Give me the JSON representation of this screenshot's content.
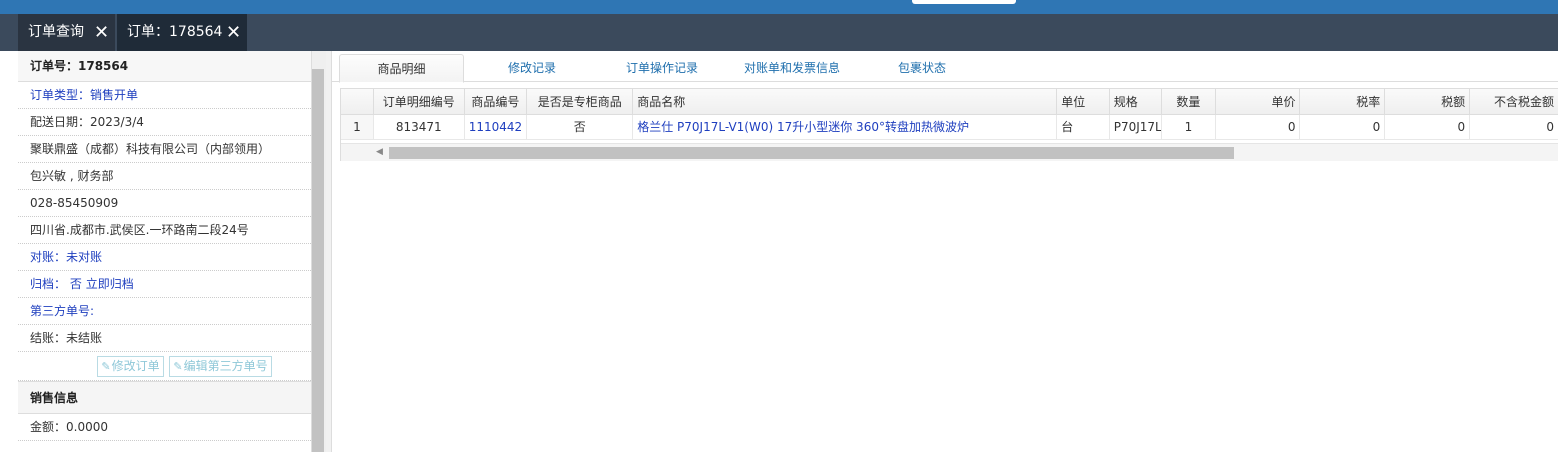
{
  "tabs": [
    {
      "label": "订单查询",
      "close": "✕"
    },
    {
      "label": "订单：178564",
      "close": "✕"
    }
  ],
  "left": {
    "order_no": "订单号：178564",
    "order_type": "订单类型：销售开单",
    "delivery_date": "配送日期：2023/3/4",
    "company": "聚联鼎盛（成都）科技有限公司（内部领用）",
    "contact": "包兴敏 , 财务部",
    "phone": "028-85450909",
    "address": "四川省.成都市.武侯区.一环路南二段24号",
    "reconcile": "对账：未对账",
    "archive_label": "归档：",
    "archive_value": "否",
    "archive_link": "立即归档",
    "third_party": "第三方单号:",
    "settlement": "结账：未结账",
    "btn_edit_order": "修改订单",
    "btn_edit_third": "编辑第三方单号",
    "sales_section": "销售信息",
    "amount": "金额：0.0000"
  },
  "right_tabs": [
    "商品明细",
    "修改记录",
    "订单操作记录",
    "对账单和发票信息",
    "包裹状态"
  ],
  "grid": {
    "headers": [
      "",
      "订单明细编号",
      "商品编号",
      "是否是专柜商品",
      "商品名称",
      "单位",
      "规格",
      "数量",
      "单价",
      "税率",
      "税额",
      "不含税金额"
    ],
    "rows": [
      [
        "1",
        "813471",
        "1110442",
        "否",
        "格兰仕 P70J17L-V1(W0) 17升小型迷你 360°转盘加热微波炉",
        "台",
        "P70J17L",
        "1",
        "0",
        "0",
        "0",
        "0"
      ]
    ]
  },
  "colors": {
    "topbar": "#2f76b4",
    "tabstrip": "#3b4a5c",
    "link": "#1f3fbf"
  }
}
